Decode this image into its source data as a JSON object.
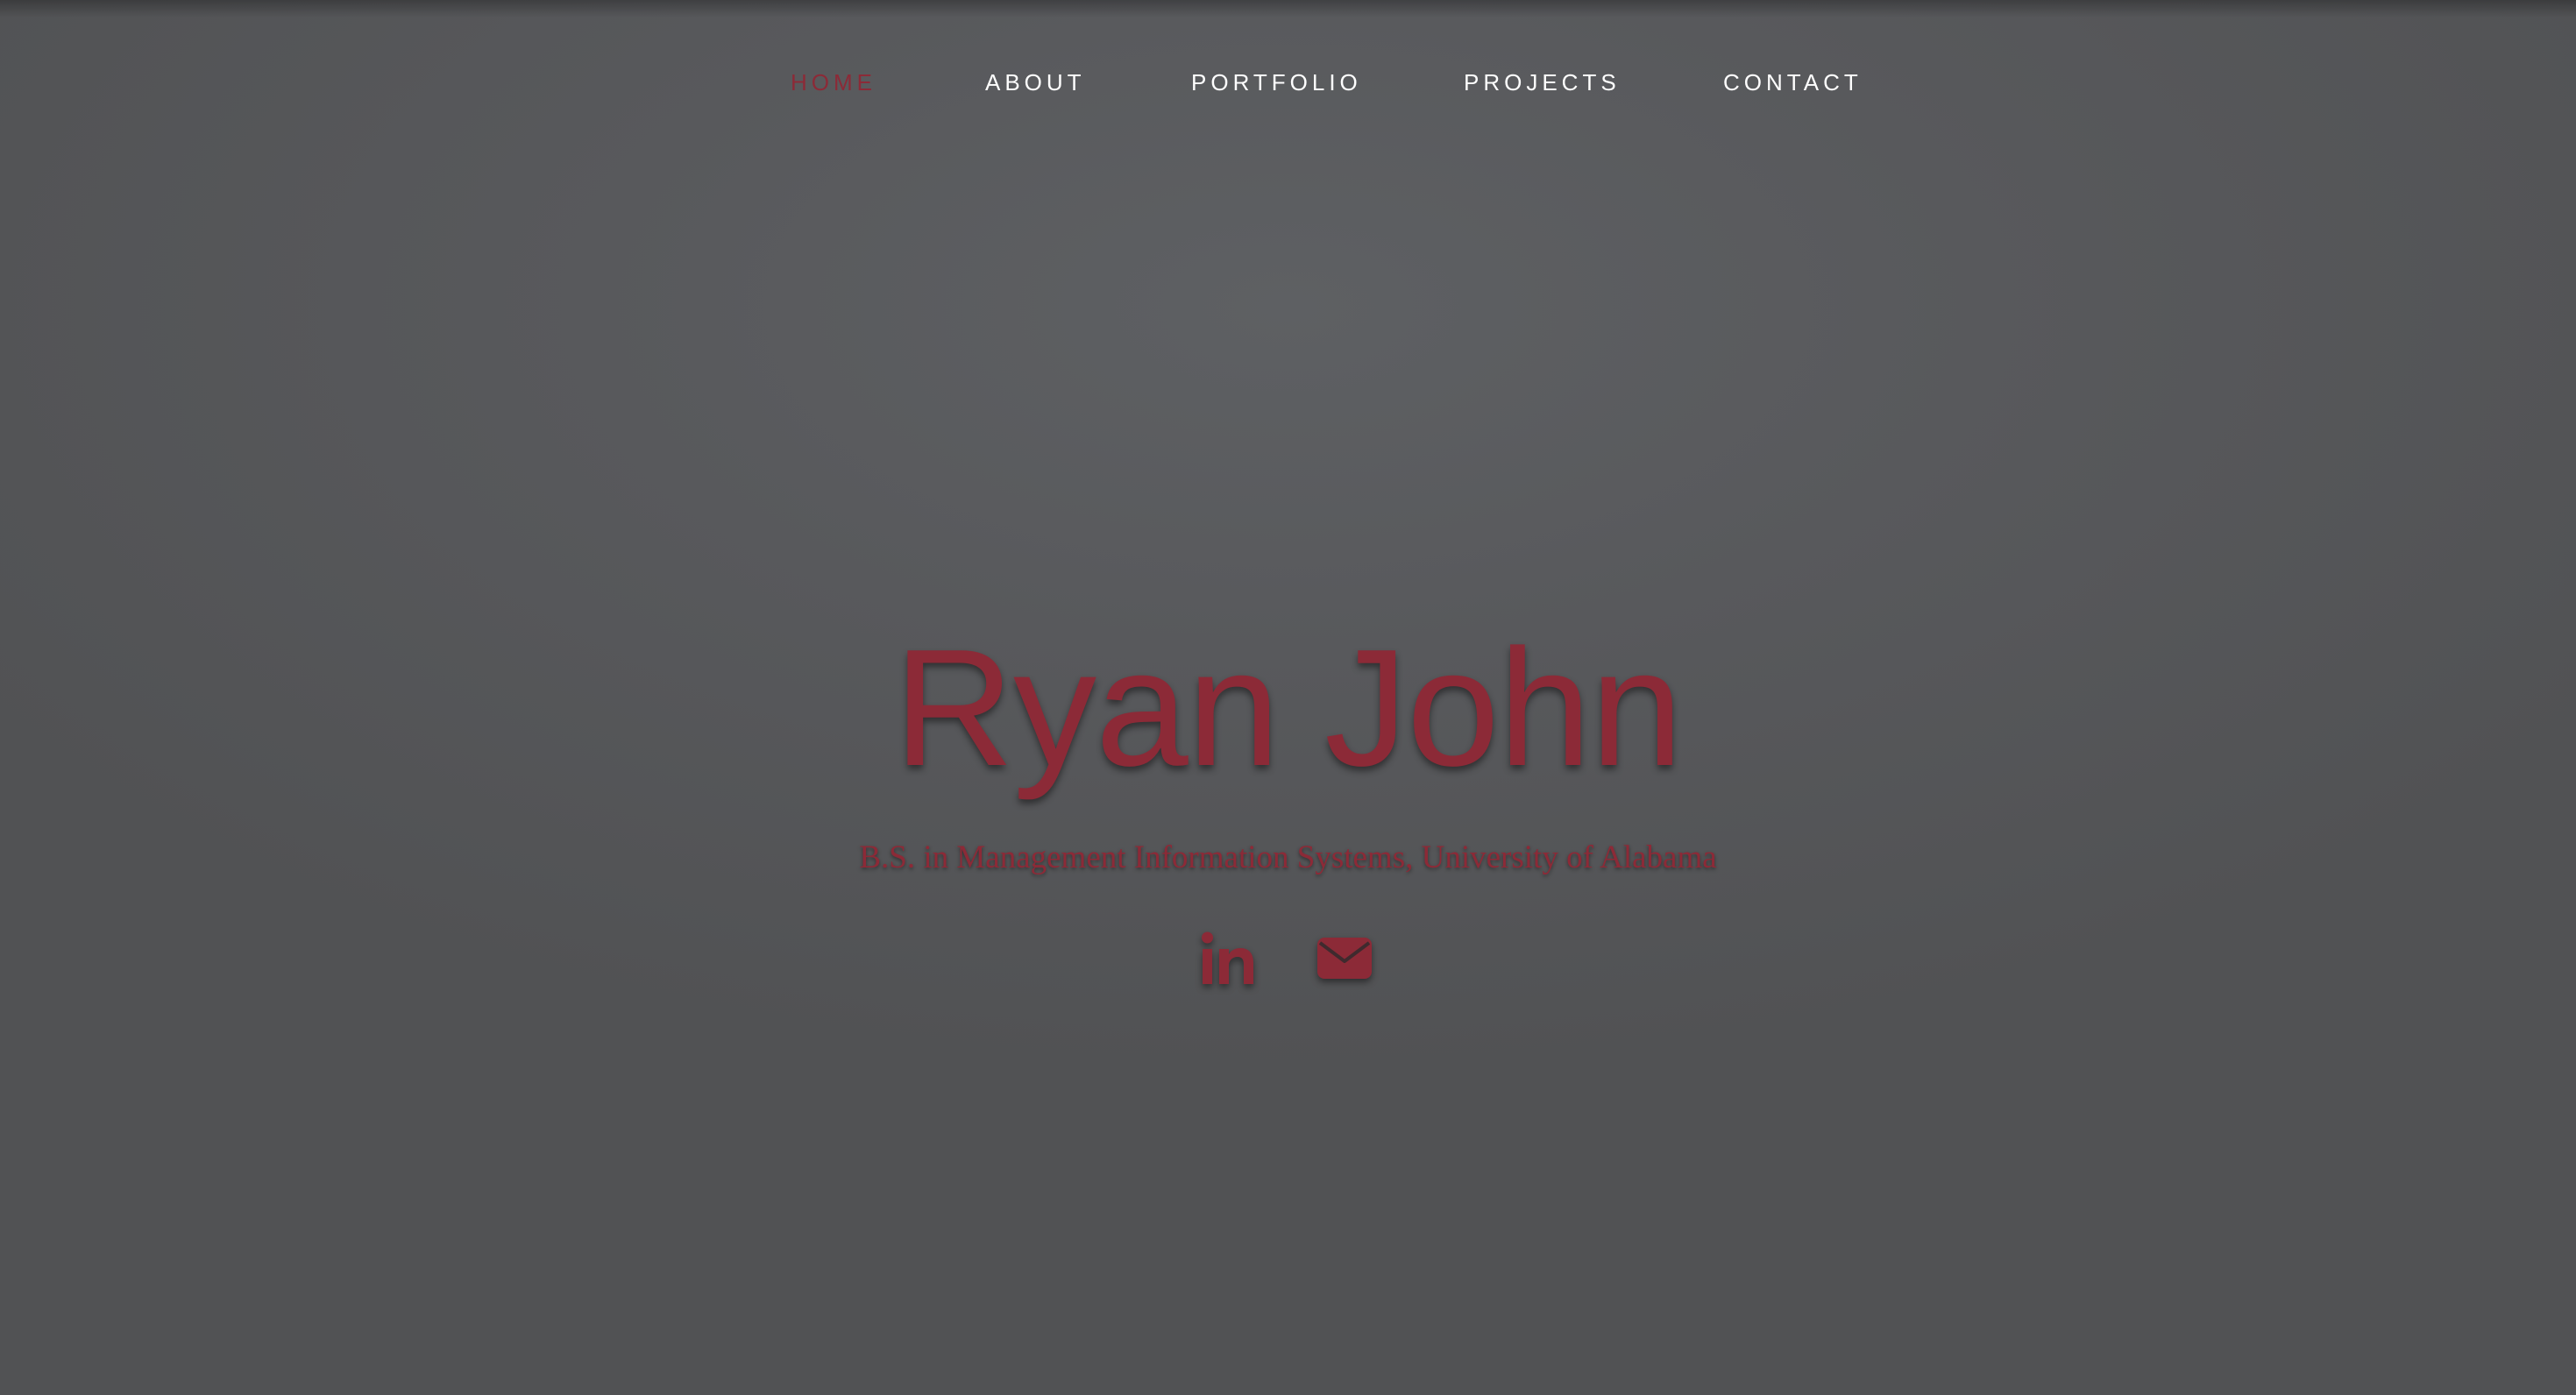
{
  "nav": {
    "items": [
      {
        "label": "HOME",
        "active": true
      },
      {
        "label": "ABOUT",
        "active": false
      },
      {
        "label": "PORTFOLIO",
        "active": false
      },
      {
        "label": "PROJECTS",
        "active": false
      },
      {
        "label": "CONTACT",
        "active": false
      }
    ]
  },
  "hero": {
    "name": "Ryan John",
    "subtitle": "B.S. in Management Information Systems, University of Alabama"
  },
  "social": {
    "icons": [
      "linkedin-icon",
      "envelope-icon"
    ]
  },
  "colors": {
    "accent": "#8c2a37",
    "nav_text": "#ffffff",
    "background": "#58595c"
  }
}
